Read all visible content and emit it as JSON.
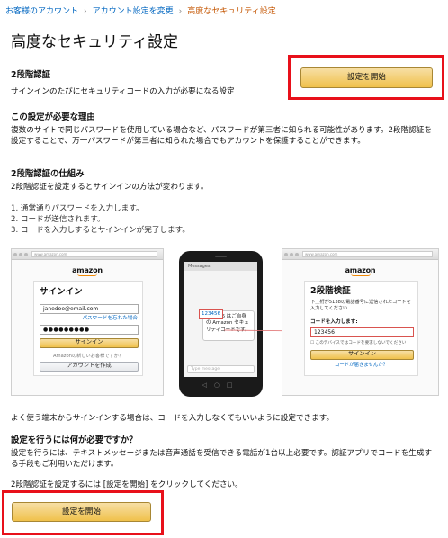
{
  "breadcrumb": {
    "items": [
      "お客様のアカウント",
      "アカウント設定を変更",
      "高度なセキュリティ設定"
    ],
    "separator": "›"
  },
  "page": {
    "title": "高度なセキュリティ設定",
    "two_step": {
      "heading": "2段階認証",
      "description": "サインインのたびにセキュリティコードの入力が必要になる設定"
    },
    "start_button_label": "設定を開始",
    "why": {
      "heading": "この設定が必要な理由",
      "text": "複数のサイトで同じパスワードを使用している場合など、パスワードが第三者に知られる可能性があります。2段階認証を設定することで、万一パスワードが第三者に知られた場合でもアカウントを保護することができます。"
    },
    "how": {
      "heading": "2段階認証の仕組み",
      "intro": "2段階認証を設定するとサインインの方法が変わります。",
      "steps": [
        "1. 通常通りパスワードを入力します。",
        "2. コードが送信されます。",
        "3. コードを入力しするとサインインが完了します。"
      ]
    },
    "illustration": {
      "signin": {
        "url": "www.amazon.com",
        "logo": "amazon",
        "title": "サインイン",
        "email": "janedoe@email.com",
        "forgot": "パスワードを忘れた場合",
        "password": "●●●●●●●●●",
        "button": "サインイン",
        "new_prompt": "Amazonの新しいお客様ですか？",
        "create_button": "アカウントを作成"
      },
      "phone": {
        "app_label": "Messages",
        "message": "123456 はご自身の Amazon セキュリティコードです。",
        "code": "123456",
        "compose_placeholder": "Type message"
      },
      "verify": {
        "url": "www.amazon.com",
        "logo": "amazon",
        "title": "2段階検証",
        "text": "下＿桁が5138の電話番号に送信されたコードを入力してください",
        "code_label": "コードを入力します:",
        "code_value": "123456",
        "remember": "このデバイスではコードを要求しないでください",
        "button": "サインイン",
        "resend": "コードが届きませんか？"
      }
    },
    "trusted_device_note": "よく使う端末からサインインする場合は、コードを入力しなくてもいいように設定できます。",
    "requirements": {
      "heading": "設定を行うには何が必要ですか？",
      "text": "設定を行うには、テキストメッセージまたは音声通話を受信できる電話が1台以上必要です。認証アプリでコードを生成する手段もご利用いただけます。"
    },
    "instruction": "2段階認証を設定するには [設定を開始] をクリックしてください。"
  },
  "colors": {
    "link": "#0066c0",
    "current_crumb": "#c45500",
    "button_top": "#f7dfa5",
    "button_bottom": "#f0c14b",
    "highlight_box": "#e8101a",
    "code_highlight": "#d9534f"
  }
}
